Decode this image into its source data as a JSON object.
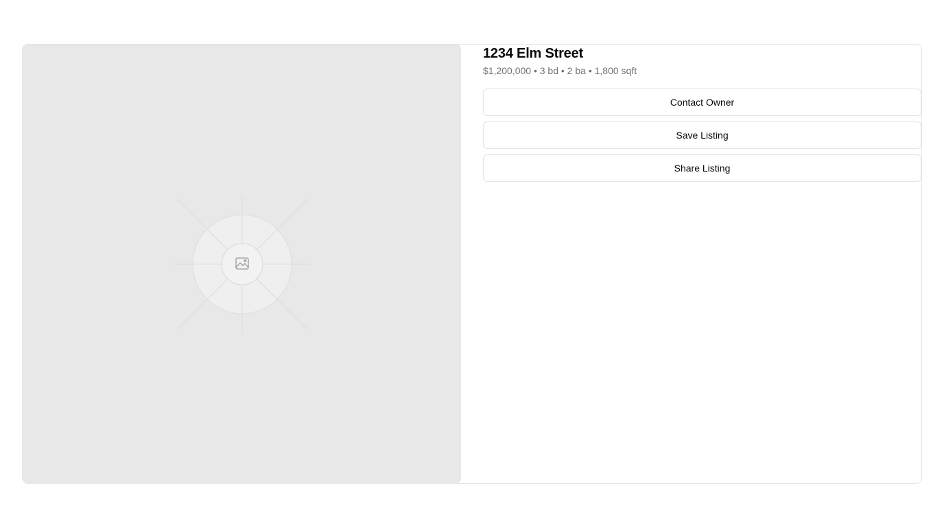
{
  "listing": {
    "title": "1234 Elm Street",
    "summary": "$1,200,000 • 3 bd • 2 ba • 1,800 sqft",
    "photo_icon": "image-placeholder-icon"
  },
  "actions": {
    "contact_label": "Contact Owner",
    "save_label": "Save Listing",
    "share_label": "Share Listing"
  },
  "colors": {
    "photo_background": "#e8e8e8",
    "border": "#e4e4e7",
    "muted_text": "#71717a"
  }
}
